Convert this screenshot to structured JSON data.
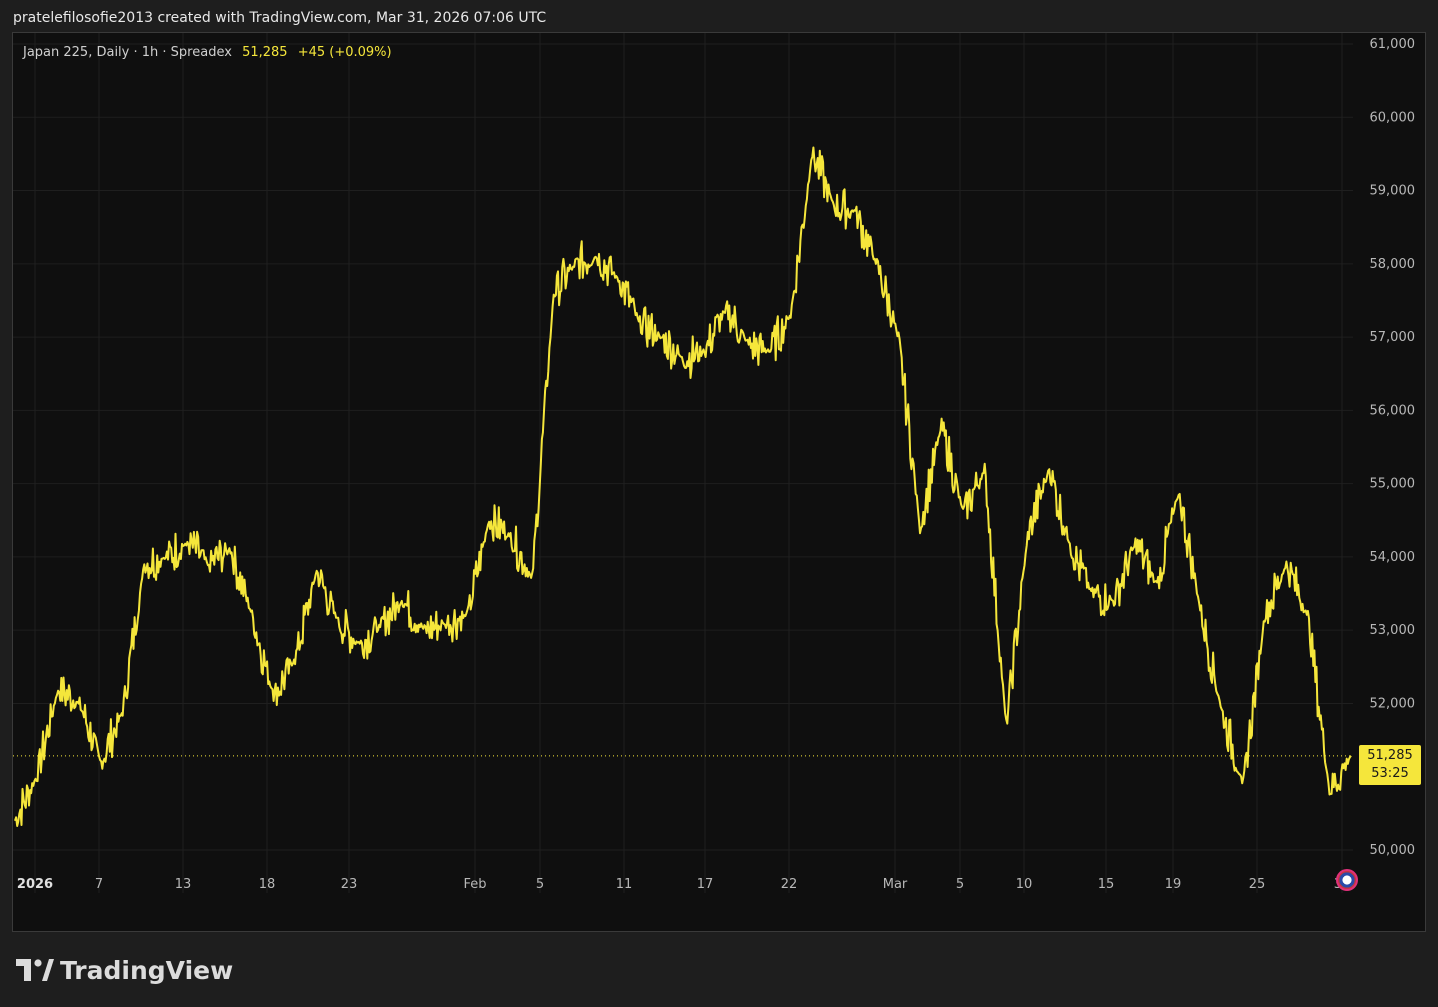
{
  "header": {
    "attribution": "pratelefilosofie2013 created with TradingView.com, Mar 31, 2026 07:06 UTC"
  },
  "legend": {
    "symbol": "Japan 225, Daily · 1h · Spreadex",
    "last_value": "51,285",
    "change": "+45 (+0.09%)"
  },
  "price_box": {
    "price": "51,285",
    "countdown": "53:25"
  },
  "footer": {
    "brand": "TradingView"
  },
  "colors": {
    "line": "#f5e63b",
    "background": "#0f0f0f",
    "grid": "#1f1f1f",
    "axis_text": "#b8b8b8"
  },
  "chart_data": {
    "type": "line",
    "series": [
      {
        "x": [
          "Jan 2",
          "Jan 5",
          "Jan 6",
          "Jan 7",
          "Jan 8",
          "Jan 9",
          "Jan 12",
          "Jan 13",
          "Jan 14",
          "Jan 15",
          "Jan 16",
          "Jan 19",
          "Jan 20",
          "Jan 21",
          "Jan 22",
          "Jan 23",
          "Jan 26",
          "Jan 27",
          "Jan 28",
          "Jan 29",
          "Jan 30",
          "Feb 2",
          "Feb 3",
          "Feb 4",
          "Feb 5",
          "Feb 6",
          "Feb 9",
          "Feb 10",
          "Feb 11",
          "Feb 12",
          "Feb 13",
          "Feb 16",
          "Feb 17",
          "Feb 18",
          "Feb 19",
          "Feb 20",
          "Feb 23",
          "Feb 24",
          "Feb 25",
          "Feb 26",
          "Feb 27",
          "Mar 2",
          "Mar 3",
          "Mar 4",
          "Mar 5",
          "Mar 6",
          "Mar 9",
          "Mar 10",
          "Mar 11",
          "Mar 12",
          "Mar 13",
          "Mar 16",
          "Mar 17",
          "Mar 18",
          "Mar 19",
          "Mar 20",
          "Mar 23",
          "Mar 24",
          "Mar 25",
          "Mar 26",
          "Mar 27",
          "Mar 30",
          "Mar 31"
        ],
        "values": [
          50400,
          51000,
          52200,
          52000,
          51200,
          51900,
          53900,
          54000,
          54200,
          53900,
          54100,
          53200,
          52100,
          52600,
          53800,
          53100,
          52800,
          53100,
          53400,
          53000,
          53100,
          53200,
          54500,
          54300,
          53700,
          57600,
          58000,
          58100,
          57800,
          57200,
          57000,
          56700,
          56800,
          57400,
          56900,
          56800,
          57300,
          59500,
          58800,
          58700,
          58000,
          57000,
          54400,
          55800,
          54600,
          55200,
          51700,
          54300,
          55200,
          54100,
          53500,
          53400,
          54200,
          53600,
          54900,
          53300,
          51900,
          50900,
          53200,
          53900,
          53200,
          50800,
          51285
        ]
      }
    ],
    "y_ticks": [
      "61,000",
      "60,000",
      "59,000",
      "58,000",
      "57,000",
      "56,000",
      "55,000",
      "54,000",
      "53,000",
      "52,000",
      "50,000"
    ],
    "x_ticks": [
      "2026",
      "7",
      "13",
      "18",
      "23",
      "Feb",
      "5",
      "11",
      "17",
      "22",
      "Mar",
      "5",
      "10",
      "15",
      "19",
      "25",
      "31"
    ],
    "ylim": [
      49400,
      61000
    ],
    "last_price": 51285,
    "grid": true
  }
}
